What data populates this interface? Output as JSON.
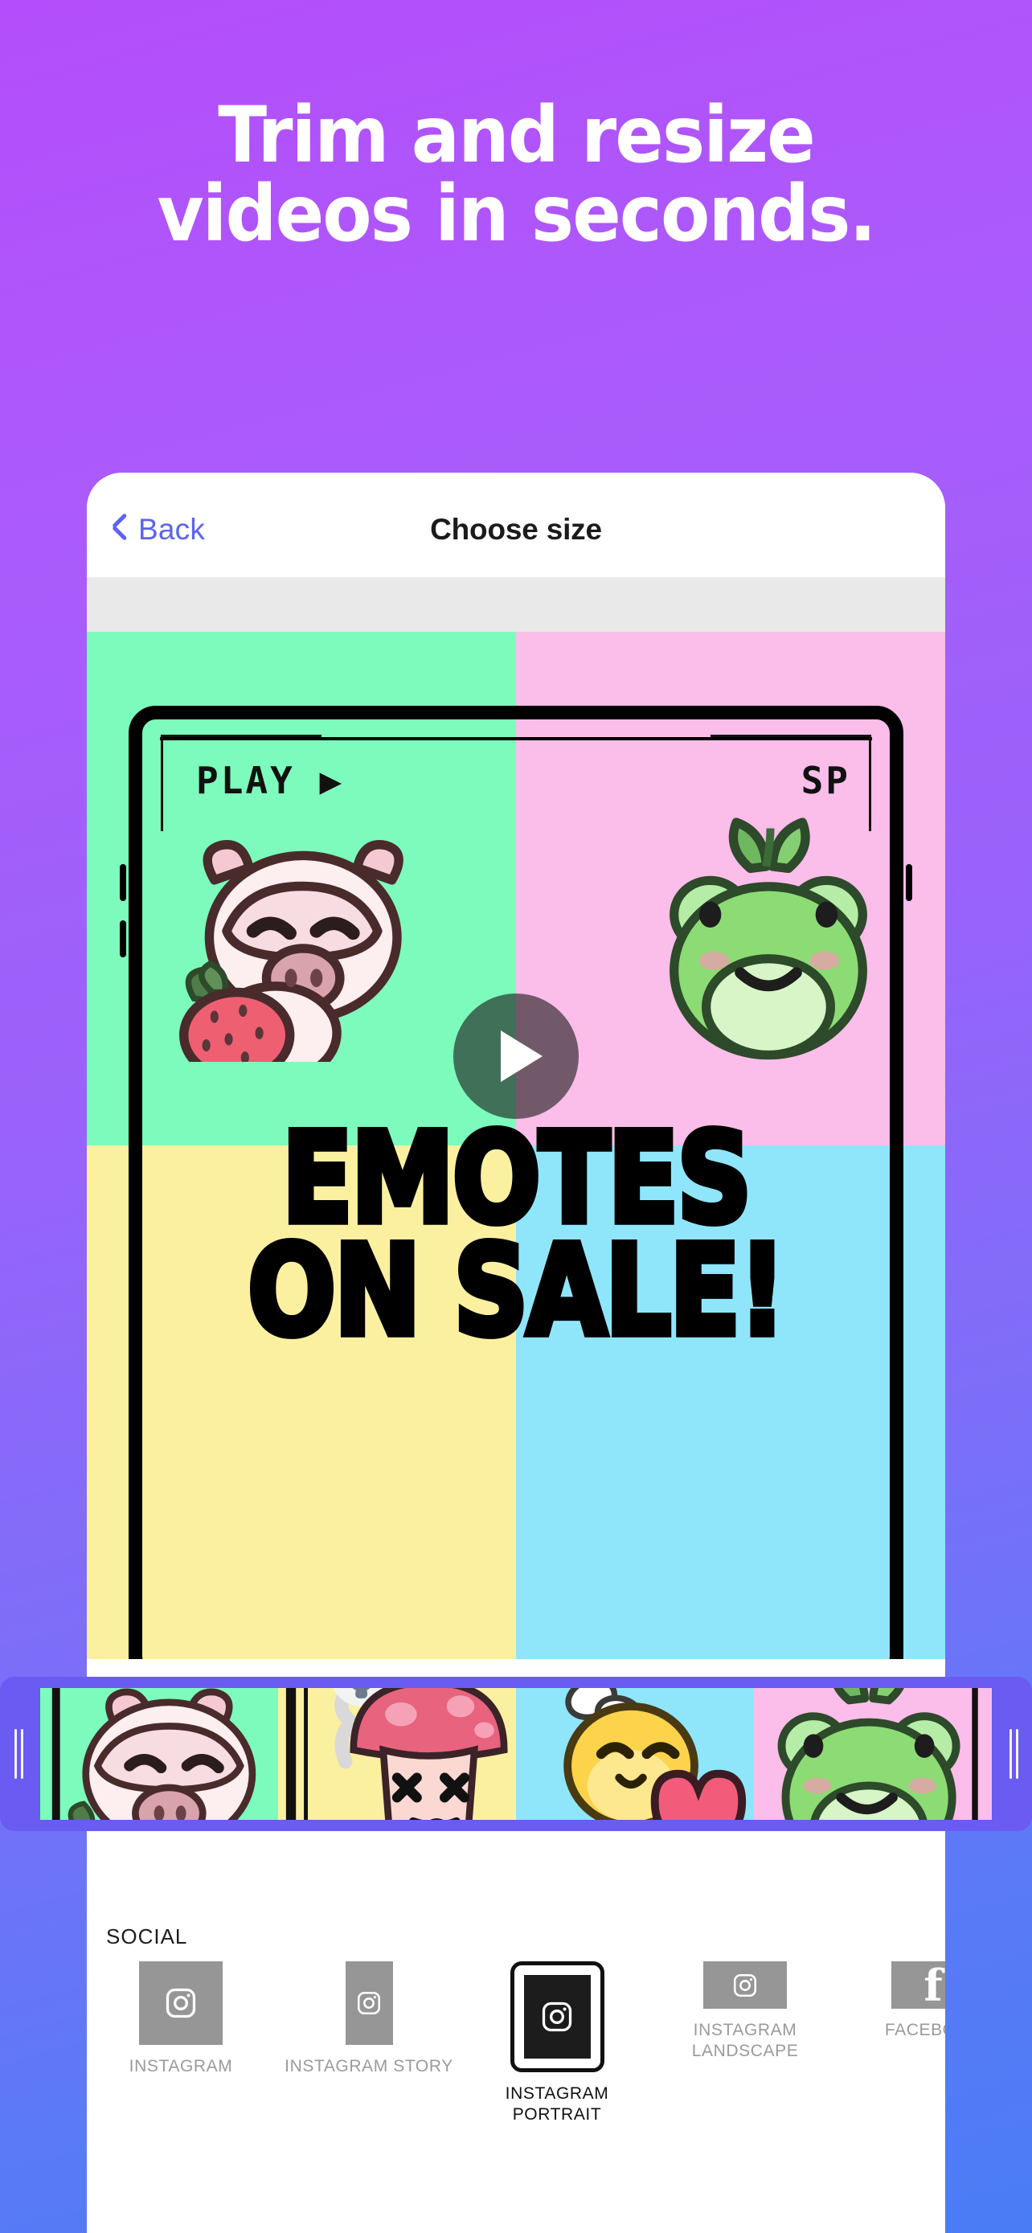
{
  "promo": {
    "headline_line1": "Trim and resize",
    "headline_line2": "videos in seconds.",
    "bg_gradient_from": "#b44dfb",
    "bg_gradient_to": "#4a7cf5"
  },
  "phone": {
    "nav": {
      "back_label": "Back",
      "title": "Choose size",
      "back_color": "#5b63f0",
      "title_color": "#1b1b1b"
    },
    "video": {
      "overlay_label": "play-button",
      "quadrant_colors": {
        "top_left": "#7dfbbc",
        "top_right": "#fbbde9",
        "bottom_left": "#fbf0a0",
        "bottom_right": "#8fe6fb"
      },
      "screen_labels": {
        "play": "PLAY ▶",
        "sp": "SP"
      },
      "title_line1": "EMOTES",
      "title_line2": "ON SALE!"
    },
    "timeline": {
      "accent_color": "#6a5bf2",
      "frames": [
        {
          "name": "frame-cow-strawberry",
          "bg": "#7dfbbc"
        },
        {
          "name": "frame-mushroom-skull",
          "bg": "#fbf0a0"
        },
        {
          "name": "frame-chick-heart",
          "bg": "#8fe6fb"
        },
        {
          "name": "frame-frog-sprout",
          "bg": "#fbbde9"
        }
      ]
    },
    "sheet": {
      "section_label": "SOCIAL",
      "presets": [
        {
          "caption": "INSTAGRAM",
          "icon": "instagram-icon",
          "w": 104,
          "h": 104,
          "selected": false
        },
        {
          "caption": "INSTAGRAM STORY",
          "icon": "instagram-icon",
          "w": 59,
          "h": 104,
          "selected": false
        },
        {
          "caption": "INSTAGRAM\nPORTRAIT",
          "icon": "instagram-icon",
          "w": 83,
          "h": 104,
          "selected": true
        },
        {
          "caption": "INSTAGRAM\nLANDSCAPE",
          "icon": "instagram-icon",
          "w": 104,
          "h": 59,
          "selected": false
        },
        {
          "caption": "FACEBOOK",
          "icon": "facebook-icon",
          "w": 104,
          "h": 59,
          "selected": false
        }
      ]
    }
  }
}
